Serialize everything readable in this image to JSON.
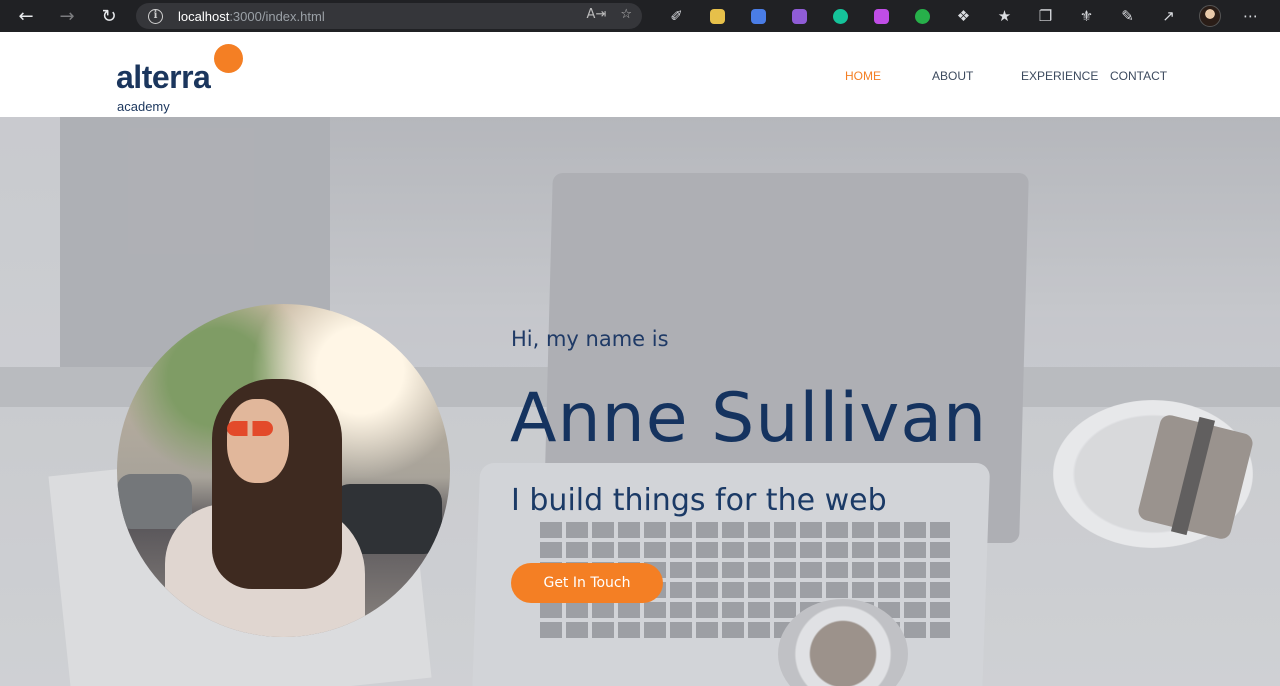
{
  "browser": {
    "url_host": "localhost",
    "url_path": ":3000/index.html",
    "extensions": [
      {
        "name": "pen-icon",
        "color": "#dadce0"
      },
      {
        "name": "mail-ext-icon",
        "color": "#e6c04a"
      },
      {
        "name": "bookmark-ext-icon",
        "color": "#4a7de6"
      },
      {
        "name": "save-ext-icon",
        "color": "#8f5cd6"
      },
      {
        "name": "grammarly-icon",
        "color": "#15c39a"
      },
      {
        "name": "color-ext-icon",
        "color": "#c04de6"
      },
      {
        "name": "eye-ext-icon",
        "color": "#27b04a"
      },
      {
        "name": "puzzle-icon",
        "color": "#dadce0"
      },
      {
        "name": "favorites-icon",
        "color": "#dadce0"
      },
      {
        "name": "collections-icon",
        "color": "#dadce0"
      },
      {
        "name": "trophy-icon",
        "color": "#dadce0"
      },
      {
        "name": "edit-page-icon",
        "color": "#dadce0"
      },
      {
        "name": "share-icon",
        "color": "#dadce0"
      },
      {
        "name": "profile-avatar",
        "color": "#2a1d17"
      },
      {
        "name": "more-icon",
        "color": "#dadce0"
      }
    ]
  },
  "logo": {
    "word": "alterra",
    "sub": "academy",
    "accent_color": "#f47f24",
    "text_color": "#1b365d"
  },
  "nav": {
    "home": "HOME",
    "about": "ABOUT",
    "experience": "EXPERIENCE",
    "contact": "CONTACT",
    "active": "HOME",
    "active_color": "#f47f24"
  },
  "hero": {
    "greeting": "Hi, my name is",
    "name": "Anne Sullivan",
    "tagline": "I build things for the web",
    "cta_label": "Get In Touch",
    "cta_color": "#f47f24",
    "text_color": "#15335f"
  }
}
